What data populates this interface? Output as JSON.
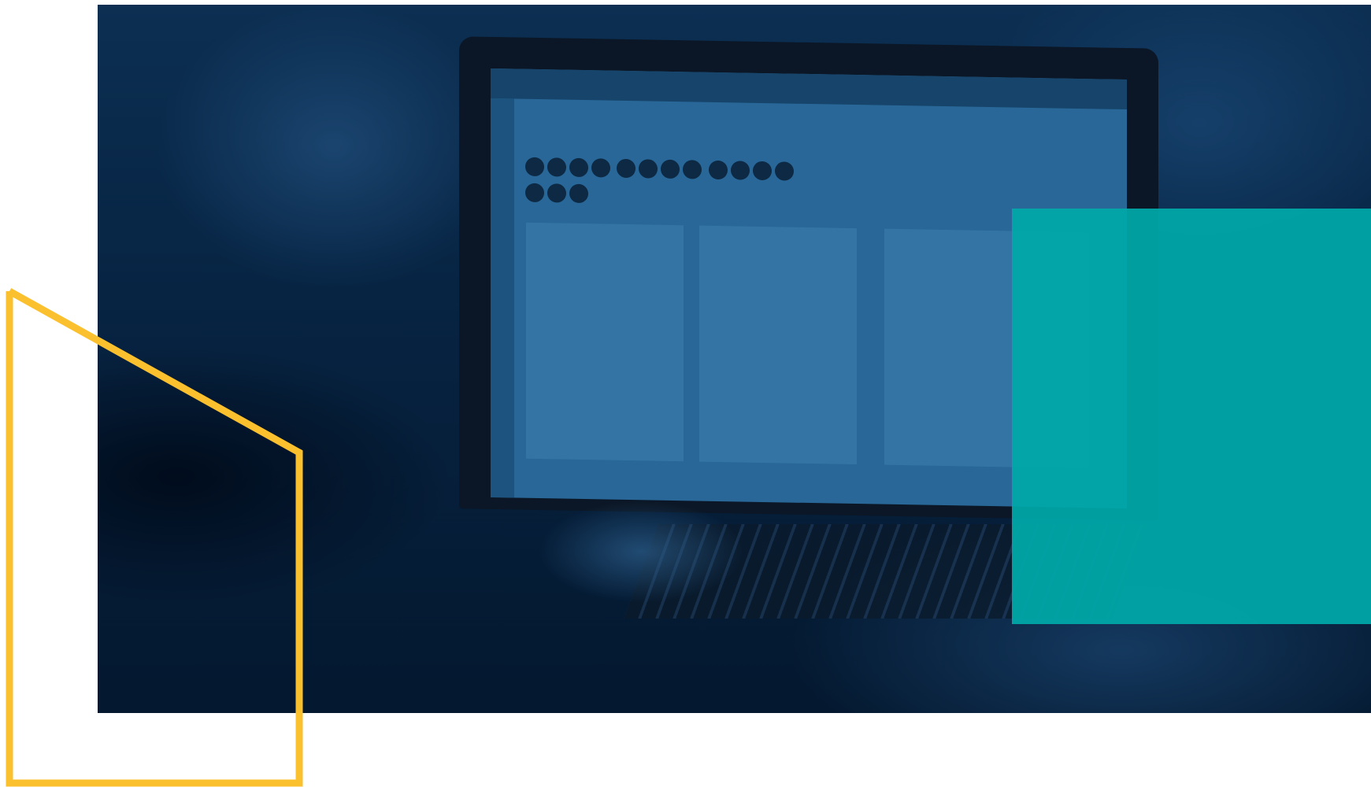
{
  "colors": {
    "photo_tint": "#031a33",
    "teal_block": "#00a9a9",
    "outline_stroke": "#fbc02d",
    "background": "#ffffff"
  }
}
